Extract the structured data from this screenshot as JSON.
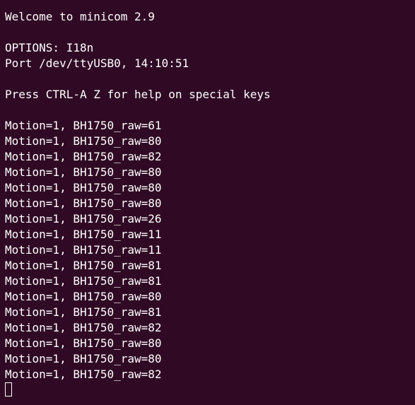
{
  "terminal": {
    "background_color": "#300a24",
    "text_color": "#ffffff",
    "banner": {
      "welcome": "Welcome to minicom 2.9",
      "options": "OPTIONS: I18n",
      "port": "Port /dev/ttyUSB0, 14:10:51",
      "help": "Press CTRL-A Z for help on special keys"
    },
    "output": [
      "Motion=1, BH1750_raw=61",
      "Motion=1, BH1750_raw=80",
      "Motion=1, BH1750_raw=82",
      "Motion=1, BH1750_raw=80",
      "Motion=1, BH1750_raw=80",
      "Motion=1, BH1750_raw=80",
      "Motion=1, BH1750_raw=26",
      "Motion=1, BH1750_raw=11",
      "Motion=1, BH1750_raw=11",
      "Motion=1, BH1750_raw=81",
      "Motion=1, BH1750_raw=81",
      "Motion=1, BH1750_raw=80",
      "Motion=1, BH1750_raw=81",
      "Motion=1, BH1750_raw=82",
      "Motion=1, BH1750_raw=80",
      "Motion=1, BH1750_raw=80",
      "Motion=1, BH1750_raw=82"
    ],
    "cursor_icon": "block-cursor-icon"
  }
}
